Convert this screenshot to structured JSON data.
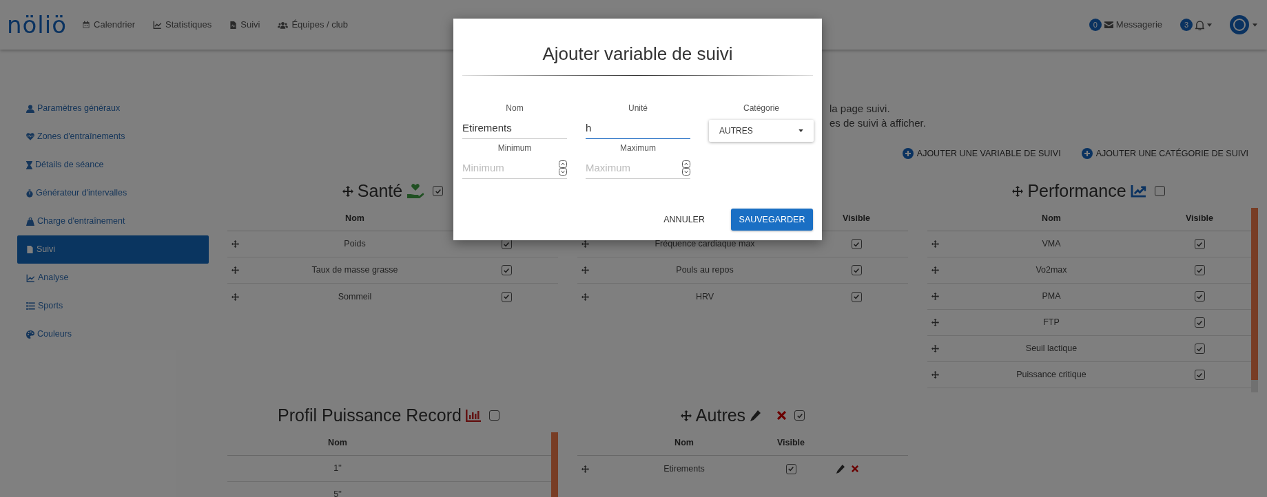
{
  "nav": {
    "logo": "nöliö",
    "items": [
      {
        "label": "Calendrier"
      },
      {
        "label": "Statistiques"
      },
      {
        "label": "Suivi"
      },
      {
        "label": "Équipes / club"
      }
    ],
    "messages": {
      "count": "0",
      "label": "Messagerie"
    },
    "notifications": {
      "count": "3"
    }
  },
  "sidebar": {
    "items": [
      {
        "label": "Paramètres généraux",
        "selected": false
      },
      {
        "label": "Zones d'entraînements",
        "selected": false
      },
      {
        "label": "Détails de séance",
        "selected": false
      },
      {
        "label": "Générateur d'intervalles",
        "selected": false
      },
      {
        "label": "Charge d'entraînement",
        "selected": false
      },
      {
        "label": "Suivi",
        "selected": true
      },
      {
        "label": "Analyse",
        "selected": false
      },
      {
        "label": "Sports",
        "selected": false
      },
      {
        "label": "Couleurs",
        "selected": false
      }
    ]
  },
  "intro_lines": [
    "la page suivi.",
    "es de suivi à afficher."
  ],
  "actions": [
    "AJOUTER UNE VARIABLE DE SUIVI",
    "AJOUTER UNE CATÉGORIE DE SUIVI"
  ],
  "categories": [
    {
      "title": "Santé",
      "visible": true,
      "kind": "draggable",
      "columns": {
        "name": "Nom"
      },
      "rows": [
        {
          "name": "Poids",
          "visible": true
        },
        {
          "name": "Taux de masse grasse",
          "visible": true
        },
        {
          "name": "Sommeil",
          "visible": true
        }
      ]
    },
    {
      "kind": "draggable",
      "columns": {
        "visible": "Visible"
      },
      "rows": [
        {
          "name": "Fréquence cardiaque max",
          "visible": true
        },
        {
          "name": "Pouls au repos",
          "visible": true
        },
        {
          "name": "HRV",
          "visible": true
        }
      ]
    },
    {
      "title": "Performance",
      "visible": false,
      "kind": "scrolling",
      "columns": {
        "name": "Nom",
        "visible": "Visible"
      },
      "rows": [
        {
          "name": "VMA",
          "visible": true
        },
        {
          "name": "Vo2max",
          "visible": true
        },
        {
          "name": "PMA",
          "visible": true
        },
        {
          "name": "FTP",
          "visible": true
        },
        {
          "name": "Seuil lactique",
          "visible": true
        },
        {
          "name": "Puissance critique",
          "visible": true
        }
      ]
    },
    {
      "title": "Profil Puissance Record",
      "visible": false,
      "kind": "fixed",
      "columns": {
        "name": "Nom"
      },
      "rows": [
        {
          "name": "1''"
        },
        {
          "name": "5''"
        }
      ]
    },
    {
      "title": "Autres",
      "visible": true,
      "kind": "custom",
      "columns": {
        "name": "Nom",
        "visible": "Visible"
      },
      "rows": [
        {
          "name": "Etirements",
          "visible": true
        }
      ]
    }
  ],
  "dialog": {
    "title": "Ajouter variable de suivi",
    "fields": [
      {
        "kind": "text",
        "label": "Nom",
        "value": "Etirements",
        "focused": false
      },
      {
        "kind": "text",
        "label": "Unité",
        "value": "h",
        "focused": true
      },
      {
        "kind": "select",
        "label": "Catégorie",
        "value": "AUTRES"
      },
      {
        "kind": "number",
        "label": "Minimum",
        "placeholder": "Minimum"
      },
      {
        "kind": "number",
        "label": "Maximum",
        "placeholder": "Maximum"
      }
    ],
    "cancel": "ANNULER",
    "save": "SAUVEGARDER"
  }
}
